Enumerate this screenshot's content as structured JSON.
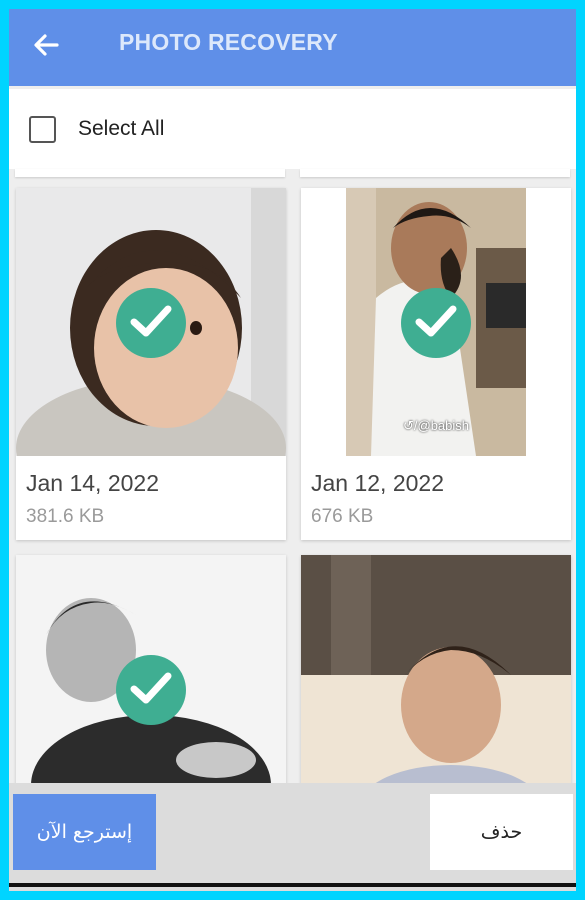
{
  "appbar": {
    "title": "PHOTO RECOVERY",
    "back_icon": "arrow-left-icon",
    "color": "#5f8fe8"
  },
  "select_all": {
    "label": "Select All",
    "checked": false
  },
  "photos": [
    {
      "date": "Jan 14, 2022",
      "size": "381.6 KB",
      "selected": true
    },
    {
      "date": "Jan 12, 2022",
      "size": "676 KB",
      "selected": true,
      "watermark": "↺/@babish"
    },
    {
      "selected": true
    },
    {
      "selected": false
    }
  ],
  "actions": {
    "recover_label": "إسترجع الآن",
    "delete_label": "حذف"
  },
  "colors": {
    "accent": "#5f8fe8",
    "check": "#3fae92",
    "frame": "#00d4ff"
  }
}
